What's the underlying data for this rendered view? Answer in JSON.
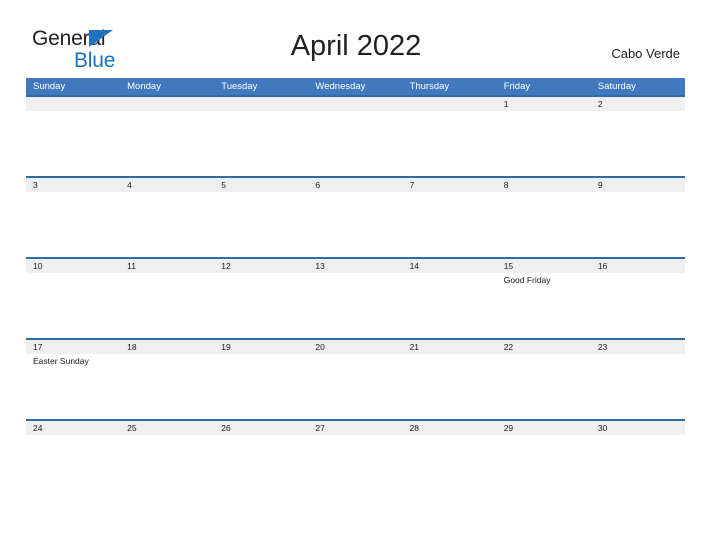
{
  "brand": {
    "line1": "General",
    "line2": "Blue",
    "triangle_color": "#1f72bd",
    "text_color": "#231f20"
  },
  "header": {
    "title": "April 2022",
    "locale": "Cabo Verde"
  },
  "colors": {
    "header_bar": "#4178be",
    "week_rule": "#2e6da4",
    "date_band": "#efefef",
    "text": "#1a1a1a",
    "page_background": "#ffffff"
  },
  "calendar": {
    "month": "April",
    "year": "2022",
    "day_headers": [
      "Sunday",
      "Monday",
      "Tuesday",
      "Wednesday",
      "Thursday",
      "Friday",
      "Saturday"
    ],
    "weeks": [
      [
        {
          "date": "",
          "event": ""
        },
        {
          "date": "",
          "event": ""
        },
        {
          "date": "",
          "event": ""
        },
        {
          "date": "",
          "event": ""
        },
        {
          "date": "",
          "event": ""
        },
        {
          "date": "1",
          "event": ""
        },
        {
          "date": "2",
          "event": ""
        }
      ],
      [
        {
          "date": "3",
          "event": ""
        },
        {
          "date": "4",
          "event": ""
        },
        {
          "date": "5",
          "event": ""
        },
        {
          "date": "6",
          "event": ""
        },
        {
          "date": "7",
          "event": ""
        },
        {
          "date": "8",
          "event": ""
        },
        {
          "date": "9",
          "event": ""
        }
      ],
      [
        {
          "date": "10",
          "event": ""
        },
        {
          "date": "11",
          "event": ""
        },
        {
          "date": "12",
          "event": ""
        },
        {
          "date": "13",
          "event": ""
        },
        {
          "date": "14",
          "event": ""
        },
        {
          "date": "15",
          "event": "Good Friday"
        },
        {
          "date": "16",
          "event": ""
        }
      ],
      [
        {
          "date": "17",
          "event": "Easter Sunday"
        },
        {
          "date": "18",
          "event": ""
        },
        {
          "date": "19",
          "event": ""
        },
        {
          "date": "20",
          "event": ""
        },
        {
          "date": "21",
          "event": ""
        },
        {
          "date": "22",
          "event": ""
        },
        {
          "date": "23",
          "event": ""
        }
      ],
      [
        {
          "date": "24",
          "event": ""
        },
        {
          "date": "25",
          "event": ""
        },
        {
          "date": "26",
          "event": ""
        },
        {
          "date": "27",
          "event": ""
        },
        {
          "date": "28",
          "event": ""
        },
        {
          "date": "29",
          "event": ""
        },
        {
          "date": "30",
          "event": ""
        }
      ]
    ]
  }
}
